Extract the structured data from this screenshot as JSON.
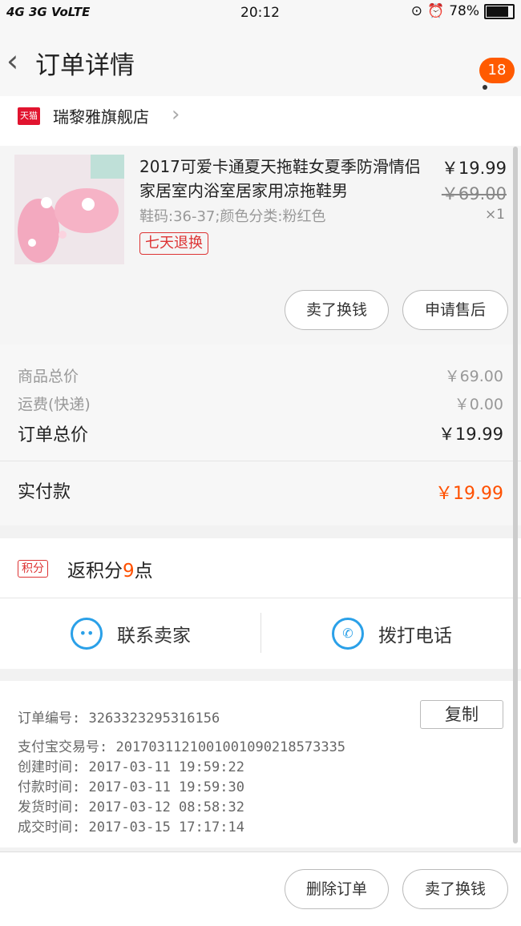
{
  "status_bar": {
    "network": "4G 3G VoLTE",
    "time": "20:12",
    "battery": "78%"
  },
  "header": {
    "title": "订单详情",
    "notification_count": "18"
  },
  "store": {
    "badge": "天猫",
    "name": "瑞黎雅旗舰店"
  },
  "item": {
    "title": "2017可爱卡通夏天拖鞋女夏季防滑情侣家居室内浴室居家用凉拖鞋男",
    "price": "￥19.99",
    "original_price": "￥69.00",
    "quantity": "×1",
    "spec": "鞋码:36-37;颜色分类:粉红色",
    "service_tag": "七天退换",
    "buttons": [
      "卖了换钱",
      "申请售后"
    ]
  },
  "totals": {
    "goods_label": "商品总价",
    "goods_value": "￥69.00",
    "shipping_label": "运费(快递)",
    "shipping_value": "￥0.00",
    "order_total_label": "订单总价",
    "order_total_value": "￥19.99",
    "paid_label": "实付款",
    "paid_value": "￥19.99"
  },
  "points": {
    "tag": "积分",
    "text_prefix": "返积分",
    "amount": "9",
    "text_suffix": "点"
  },
  "contact": {
    "seller": "联系卖家",
    "phone": "拨打电话"
  },
  "order_info": {
    "copy_label": "复制",
    "rows": [
      "订单编号:  3263323295316156",
      "支付宝交易号:  2017031121001001090218573335",
      "创建时间:  2017-03-11 19:59:22",
      "付款时间:  2017-03-11 19:59:30",
      "发货时间:  2017-03-12 08:58:32",
      "成交时间:  2017-03-15 17:17:14"
    ]
  },
  "bottom_actions": [
    "删除订单",
    "卖了换钱"
  ],
  "colors": {
    "accent_orange": "#ff5000",
    "tmall_red": "#e1142f",
    "icon_blue": "#2aa0e8"
  }
}
